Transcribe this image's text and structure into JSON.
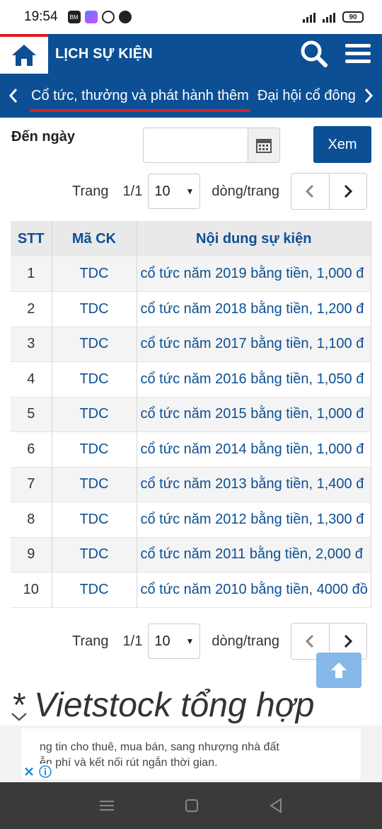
{
  "status": {
    "time": "19:54",
    "notif_icons": [
      "bao-moi-icon",
      "app-icon",
      "vpn-icon",
      "football-icon"
    ],
    "battery": "90"
  },
  "header": {
    "title": "LỊCH SỰ KIỆN"
  },
  "tabs": [
    {
      "label": "Cổ tức, thưởng và phát hành thêm",
      "active": true
    },
    {
      "label": "Đại hội cổ đông",
      "active": false
    }
  ],
  "filter": {
    "label": "Đến ngày",
    "date_value": "",
    "button": "Xem"
  },
  "pagination": {
    "trang_label": "Trang",
    "page": "1/1",
    "per_page": "10",
    "per_page_suffix": "dòng/trang"
  },
  "table": {
    "headers": [
      "STT",
      "Mã CK",
      "Nội dung sự kiện"
    ],
    "rows": [
      {
        "stt": "1",
        "ma": "TDC",
        "noi_dung": "cổ tức năm 2019 bằng tiền, 1,000 đ"
      },
      {
        "stt": "2",
        "ma": "TDC",
        "noi_dung": "cổ tức năm 2018 bằng tiền, 1,200 đ"
      },
      {
        "stt": "3",
        "ma": "TDC",
        "noi_dung": "cổ tức năm 2017 bằng tiền, 1,100 đ"
      },
      {
        "stt": "4",
        "ma": "TDC",
        "noi_dung": "cổ tức năm 2016 bằng tiền, 1,050 đ"
      },
      {
        "stt": "5",
        "ma": "TDC",
        "noi_dung": "cổ tức năm 2015 bằng tiền, 1,000 đ"
      },
      {
        "stt": "6",
        "ma": "TDC",
        "noi_dung": "cổ tức năm 2014 bằng tiền, 1,000 đ"
      },
      {
        "stt": "7",
        "ma": "TDC",
        "noi_dung": "cổ tức năm 2013 bằng tiền, 1,400 đ"
      },
      {
        "stt": "8",
        "ma": "TDC",
        "noi_dung": "cổ tức năm 2012 bằng tiền, 1,300 đ"
      },
      {
        "stt": "9",
        "ma": "TDC",
        "noi_dung": "cổ tức năm 2011 bằng tiền, 2,000 đ"
      },
      {
        "stt": "10",
        "ma": "TDC",
        "noi_dung": "cổ tức năm 2010 bằng tiền, 4000 đồ"
      }
    ]
  },
  "promo": {
    "heading": "* Vietstock tổng hợp"
  },
  "ad": {
    "line1": "ng tin cho thuê, mua bán, sang nhượng nhà đất",
    "line2": "ễn phí và kết nối rút ngắn thời gian."
  },
  "colors": {
    "brand_blue": "#0c4f94",
    "accent_red": "#e21b23",
    "scroll_top": "#86b8ea"
  }
}
